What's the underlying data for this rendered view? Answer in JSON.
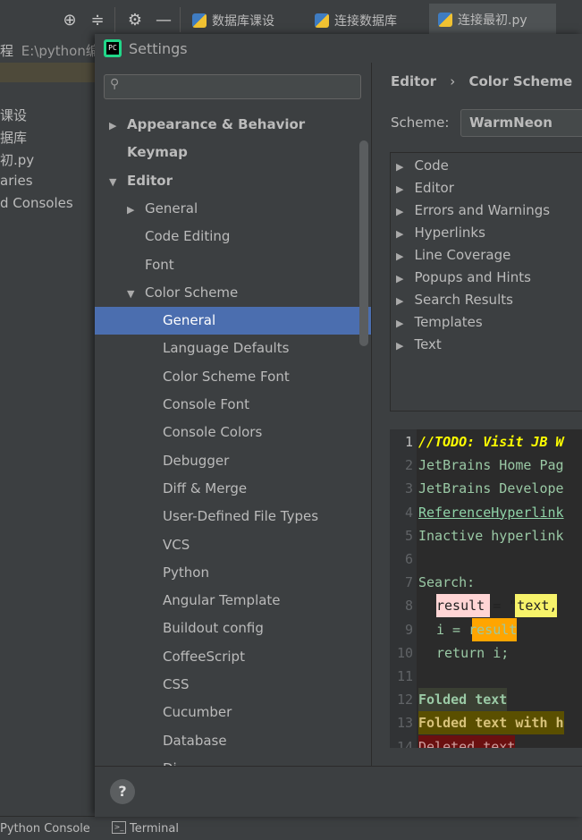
{
  "toolbar": {
    "icons": [
      "crosshair-icon",
      "collapse-icon",
      "gear-icon",
      "minimize-icon"
    ],
    "tabs": [
      {
        "label": "数据库课设",
        "active": false
      },
      {
        "label": "连接数据库",
        "active": false
      },
      {
        "label": "连接最初.py",
        "active": true
      }
    ]
  },
  "project_panel": {
    "path_prefix": "程",
    "path": "E:\\python编和",
    "items": [
      "课设",
      "据库",
      "初.py",
      "aries",
      "d Consoles"
    ]
  },
  "bottom_bar": {
    "python_console": "Python Console",
    "terminal": "Terminal"
  },
  "dialog": {
    "title": "Settings",
    "logo_text": "PC",
    "search_placeholder": "",
    "tree": [
      {
        "label": "Appearance & Behavior",
        "indent": 0,
        "arrow": "▶",
        "bold": true
      },
      {
        "label": "Keymap",
        "indent": 0,
        "arrow": "",
        "bold": true
      },
      {
        "label": "Editor",
        "indent": 0,
        "arrow": "▼",
        "bold": true
      },
      {
        "label": "General",
        "indent": 1,
        "arrow": "▶"
      },
      {
        "label": "Code Editing",
        "indent": 1,
        "arrow": ""
      },
      {
        "label": "Font",
        "indent": 1,
        "arrow": ""
      },
      {
        "label": "Color Scheme",
        "indent": 1,
        "arrow": "▼"
      },
      {
        "label": "General",
        "indent": 2,
        "arrow": "",
        "selected": true
      },
      {
        "label": "Language Defaults",
        "indent": 2,
        "arrow": ""
      },
      {
        "label": "Color Scheme Font",
        "indent": 2,
        "arrow": ""
      },
      {
        "label": "Console Font",
        "indent": 2,
        "arrow": ""
      },
      {
        "label": "Console Colors",
        "indent": 2,
        "arrow": ""
      },
      {
        "label": "Debugger",
        "indent": 2,
        "arrow": ""
      },
      {
        "label": "Diff & Merge",
        "indent": 2,
        "arrow": ""
      },
      {
        "label": "User-Defined File Types",
        "indent": 2,
        "arrow": ""
      },
      {
        "label": "VCS",
        "indent": 2,
        "arrow": ""
      },
      {
        "label": "Python",
        "indent": 2,
        "arrow": ""
      },
      {
        "label": "Angular Template",
        "indent": 2,
        "arrow": ""
      },
      {
        "label": "Buildout config",
        "indent": 2,
        "arrow": ""
      },
      {
        "label": "CoffeeScript",
        "indent": 2,
        "arrow": ""
      },
      {
        "label": "CSS",
        "indent": 2,
        "arrow": ""
      },
      {
        "label": "Cucumber",
        "indent": 2,
        "arrow": ""
      },
      {
        "label": "Database",
        "indent": 2,
        "arrow": ""
      },
      {
        "label": "Di...",
        "indent": 2,
        "arrow": ""
      }
    ],
    "breadcrumb": [
      "Editor",
      "Color Scheme"
    ],
    "breadcrumb_sep": "›",
    "scheme_label": "Scheme:",
    "scheme_value": "WarmNeon",
    "categories": [
      "Code",
      "Editor",
      "Errors and Warnings",
      "Hyperlinks",
      "Line Coverage",
      "Popups and Hints",
      "Search Results",
      "Templates",
      "Text"
    ],
    "preview_lines": [
      {
        "n": "1",
        "text": "//TODO: Visit JB W"
      },
      {
        "n": "2",
        "text": "JetBrains Home Pag"
      },
      {
        "n": "3",
        "text": "JetBrains Develope"
      },
      {
        "n": "4",
        "text": "ReferenceHyperlink"
      },
      {
        "n": "5",
        "text": "Inactive hyperlink"
      },
      {
        "n": "6",
        "text": ""
      },
      {
        "n": "7",
        "text": "Search:"
      },
      {
        "n": "8",
        "text": "result = \"text,"
      },
      {
        "n": "9",
        "text": "i = result"
      },
      {
        "n": "10",
        "text": "return i;"
      },
      {
        "n": "11",
        "text": ""
      },
      {
        "n": "12",
        "text": "Folded text"
      },
      {
        "n": "13",
        "text": "Folded text with h"
      },
      {
        "n": "14",
        "text": "Deleted text"
      }
    ],
    "help_label": "?"
  },
  "colors": {
    "selection": "#4b6eaf",
    "todo": "#ffff00",
    "background": "#3c3f41"
  }
}
